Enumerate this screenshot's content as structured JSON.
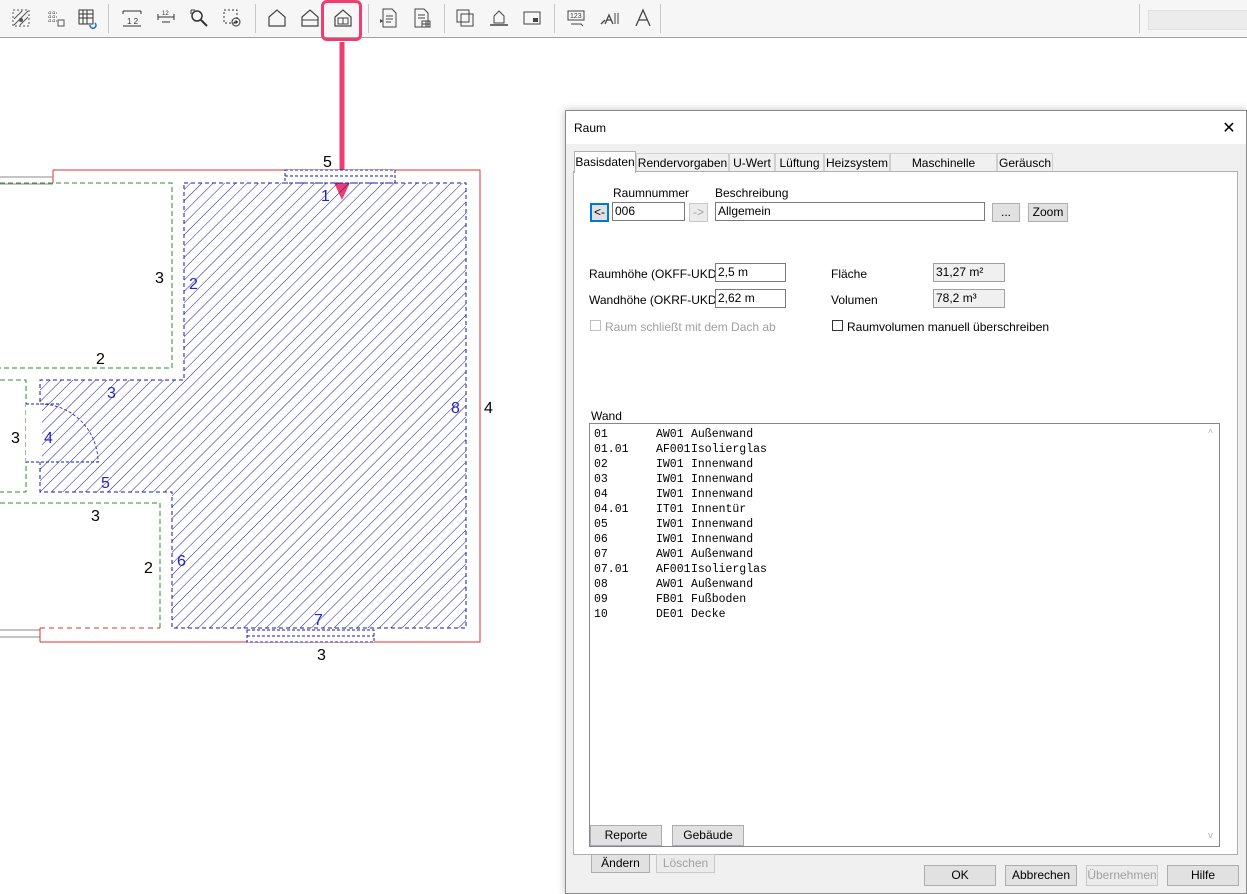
{
  "dialog": {
    "title": "Raum",
    "close": "✕",
    "tabs": [
      "Basisdaten",
      "Rendervorgaben",
      "U-Wert",
      "Lüftung",
      "Heizsystem",
      "Maschinelle Lüftung",
      "Geräusch"
    ],
    "active_tab": "Basisdaten",
    "room_number_label": "Raumnummer",
    "description_label": "Beschreibung",
    "prev_button": "<-",
    "next_button": "->",
    "room_number": "006",
    "description": "Allgemein",
    "browse_button": "...",
    "zoom_button": "Zoom",
    "room_height_label": "Raumhöhe (OKFF-UKD)",
    "room_height": "2,5 m",
    "wall_height_label": "Wandhöhe (OKRF-UKD)",
    "wall_height": "2,62 m",
    "area_label": "Fläche",
    "area": "31,27 m²",
    "volume_label": "Volumen",
    "volume": "78,2 m³",
    "roof_checkbox_label": "Raum schließt mit dem Dach ab",
    "volume_override_label": "Raumvolumen manuell überschreiben",
    "wall_section_label": "Wand",
    "walls": [
      [
        "01",
        "AW01",
        "Außenwand"
      ],
      [
        "01.01",
        "AF001",
        "Isolierglas"
      ],
      [
        "02",
        "IW01",
        "Innenwand"
      ],
      [
        "03",
        "IW01",
        "Innenwand"
      ],
      [
        "04",
        "IW01",
        "Innenwand"
      ],
      [
        "04.01",
        "IT01",
        "Innentür"
      ],
      [
        "05",
        "IW01",
        "Innenwand"
      ],
      [
        "06",
        "IW01",
        "Innenwand"
      ],
      [
        "07",
        "AW01",
        "Außenwand"
      ],
      [
        "07.01",
        "AF001",
        "Isolierglas"
      ],
      [
        "08",
        "AW01",
        "Außenwand"
      ],
      [
        "09",
        "FB01",
        "Fußboden"
      ],
      [
        "10",
        "DE01",
        "Decke"
      ]
    ],
    "change_button": "Ändern",
    "delete_button": "Löschen",
    "reports_button": "Reporte",
    "building_button": "Gebäude",
    "ok_button": "OK",
    "cancel_button": "Abbrechen",
    "apply_button": "Übernehmen",
    "help_button": "Hilfe"
  },
  "plan": {
    "labels": {
      "top": "5",
      "left_upper": "3",
      "left_upper_bottom": "2",
      "left_mid": "3",
      "left_mid_bottom": "3",
      "left_lower": "2",
      "bottom": "3",
      "right": "4",
      "wall_numbers": [
        "1",
        "2",
        "3",
        "4",
        "5",
        "6",
        "7",
        "8"
      ]
    }
  },
  "colors": {
    "highlight": "#ee3d6e",
    "room_hatch": "#1a1aa8",
    "outer_wall": "#e03030",
    "inner_wall_green": "#2e8b2e"
  },
  "toolbar_icons": [
    "grid-hatch-icon",
    "grid-dots-icon",
    "grid-frame-icon",
    "measure-icon",
    "dimension-icon",
    "zoom-select-icon",
    "select-area-icon",
    "house-icon",
    "house-roof-icon",
    "room-icon",
    "report-icon",
    "report-list-icon",
    "copy-frame-icon",
    "level-icon",
    "panel-icon",
    "number-field-icon",
    "text-style-icon",
    "text-icon"
  ]
}
